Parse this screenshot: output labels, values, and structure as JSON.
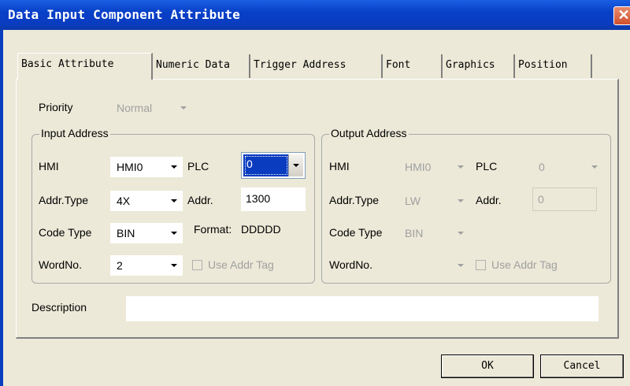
{
  "window": {
    "title": "Data Input Component Attribute",
    "close_glyph": "✕"
  },
  "tabs": [
    {
      "label": "Basic Attribute",
      "active": true
    },
    {
      "label": "Numeric Data"
    },
    {
      "label": "Trigger Address"
    },
    {
      "label": "Font"
    },
    {
      "label": "Graphics"
    },
    {
      "label": "Position"
    }
  ],
  "priority": {
    "label": "Priority",
    "value": "Normal"
  },
  "input": {
    "group_title": "Input Address",
    "hmi_label": "HMI",
    "hmi_value": "HMI0",
    "plc_label": "PLC",
    "plc_value": "0",
    "addr_type_label": "Addr.Type",
    "addr_type_value": "4X",
    "addr_label": "Addr.",
    "addr_value": "1300",
    "code_type_label": "Code Type",
    "code_type_value": "BIN",
    "format_label": "Format:",
    "format_value": "DDDDD",
    "wordno_label": "WordNo.",
    "wordno_value": "2",
    "use_addr_tag_label": "Use Addr Tag"
  },
  "output": {
    "group_title": "Output Address",
    "hmi_label": "HMI",
    "hmi_value": "HMI0",
    "plc_label": "PLC",
    "plc_value": "0",
    "addr_type_label": "Addr.Type",
    "addr_type_value": "LW",
    "addr_label": "Addr.",
    "addr_value": "0",
    "code_type_label": "Code Type",
    "code_type_value": "BIN",
    "wordno_label": "WordNo.",
    "wordno_value": "",
    "use_addr_tag_label": "Use Addr Tag"
  },
  "description": {
    "label": "Description",
    "value": ""
  },
  "buttons": {
    "ok": "OK",
    "cancel": "Cancel"
  }
}
